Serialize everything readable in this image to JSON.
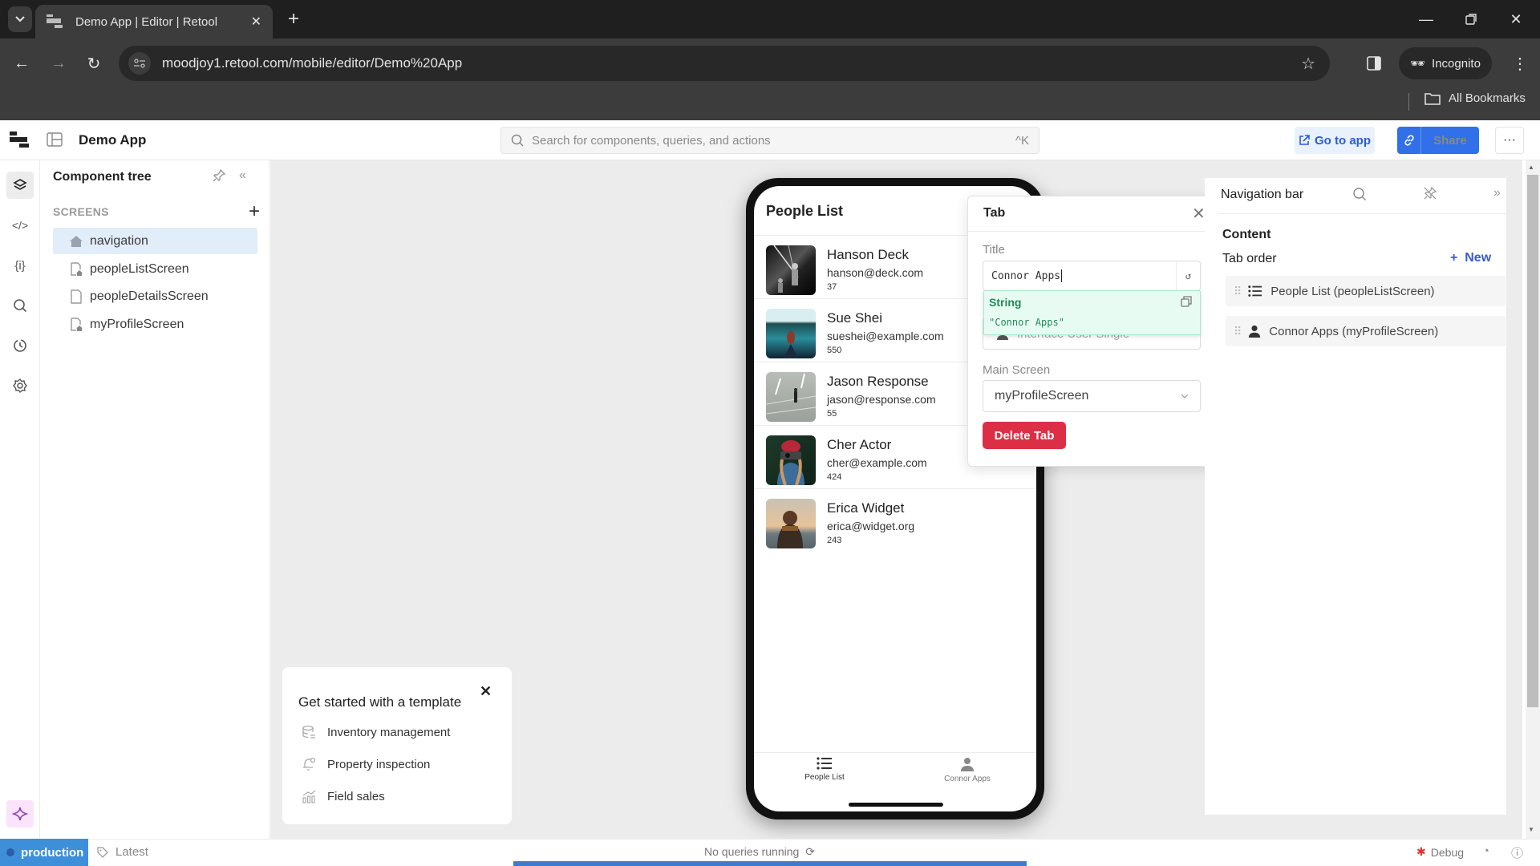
{
  "browser": {
    "tab_title": "Demo App | Editor | Retool",
    "url": "moodjoy1.retool.com/mobile/editor/Demo%20App",
    "incognito_label": "Incognito",
    "bookmarks_label": "All Bookmarks"
  },
  "header": {
    "app_name": "Demo App",
    "search_placeholder": "Search for components, queries, and actions",
    "search_shortcut": "^K",
    "goto_label": "Go to app",
    "share_label": "Share",
    "more_label": "···"
  },
  "tree": {
    "title": "Component tree",
    "section_label": "SCREENS",
    "items": [
      {
        "label": "navigation",
        "icon": "home-icon",
        "selected": true
      },
      {
        "label": "peopleListScreen",
        "icon": "screen-home-icon"
      },
      {
        "label": "peopleDetailsScreen",
        "icon": "screen-icon"
      },
      {
        "label": "myProfileScreen",
        "icon": "screen-home-icon"
      }
    ]
  },
  "template_card": {
    "title": "Get started with a template",
    "items": [
      {
        "label": "Inventory management",
        "icon": "database-icon"
      },
      {
        "label": "Property inspection",
        "icon": "bell-icon"
      },
      {
        "label": "Field sales",
        "icon": "bar-chart-icon"
      }
    ]
  },
  "phone": {
    "screen_title": "People List",
    "people": [
      {
        "name": "Hanson Deck",
        "email": "hanson@deck.com",
        "number": "37"
      },
      {
        "name": "Sue Shei",
        "email": "sueshei@example.com",
        "number": "550"
      },
      {
        "name": "Jason Response",
        "email": "jason@response.com",
        "number": "55"
      },
      {
        "name": "Cher Actor",
        "email": "cher@example.com",
        "number": "424"
      },
      {
        "name": "Erica Widget",
        "email": "erica@widget.org",
        "number": "243"
      }
    ],
    "tabs": [
      {
        "label": "People List",
        "icon": "list-icon"
      },
      {
        "label": "Connor Apps",
        "icon": "person-icon"
      }
    ]
  },
  "tab_popover": {
    "title": "Tab",
    "title_label": "Title",
    "title_value": "Connor Apps",
    "eval_type": "String",
    "eval_value": "\"Connor Apps\"",
    "icon_value": "Interface User Single",
    "main_screen_label": "Main Screen",
    "main_screen_value": "myProfileScreen",
    "delete_label": "Delete Tab"
  },
  "inspector": {
    "title": "Navigation bar",
    "content_label": "Content",
    "tab_order_label": "Tab order",
    "new_label": "New",
    "tabs": [
      {
        "label": "People List (peopleListScreen)",
        "icon": "list-icon"
      },
      {
        "label": "Connor Apps (myProfileScreen)",
        "icon": "person-icon"
      }
    ]
  },
  "footer": {
    "environment": "production",
    "version": "Latest",
    "query_status": "No queries running",
    "debug_label": "Debug"
  },
  "colors": {
    "accent": "#3170e8",
    "danger": "#dc2f45",
    "environment": "#3e8fd9",
    "eval_success": "#1f8a58"
  }
}
